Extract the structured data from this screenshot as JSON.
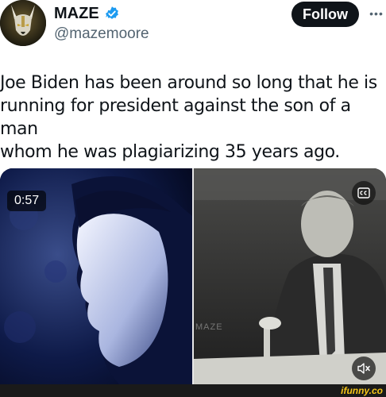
{
  "author": {
    "display_name": "MAZE",
    "handle": "@mazemoore",
    "verified": true,
    "avatar_icon": "jackal-mask-avatar"
  },
  "actions": {
    "follow_label": "Follow",
    "more_label": "•••"
  },
  "tweet": {
    "text": "Joe Biden has been around so long that he is\nrunning for president against the son of a man\nwhom he was plagiarizing 35 years ago."
  },
  "media": {
    "duration": "0:57",
    "watermark": "MAZE",
    "captions_icon": "closed-captions-icon",
    "mute_icon": "speaker-muted-icon"
  },
  "footer": {
    "site": "ifunny.co"
  },
  "colors": {
    "text": "#0f1419",
    "secondary_text": "#536471",
    "verified_blue": "#1d9bf0",
    "follow_bg": "#0f1419",
    "footer_bg": "#1a1a1a",
    "brand_yellow": "#f5c518"
  }
}
